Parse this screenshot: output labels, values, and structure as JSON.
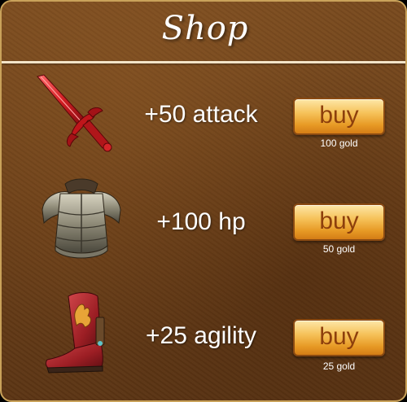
{
  "shop": {
    "title": "Shop",
    "items": [
      {
        "stat": "+50 attack",
        "button_label": "buy",
        "price": "100 gold",
        "icon": "sword-icon"
      },
      {
        "stat": "+100 hp",
        "button_label": "buy",
        "price": "50 gold",
        "icon": "armor-icon"
      },
      {
        "stat": "+25 agility",
        "button_label": "buy",
        "price": "25 gold",
        "icon": "boot-icon"
      }
    ]
  },
  "colors": {
    "background": "#6b3f18",
    "border": "#c9a25a",
    "button": "#f6c25a",
    "button_text": "#8d3f0c"
  }
}
